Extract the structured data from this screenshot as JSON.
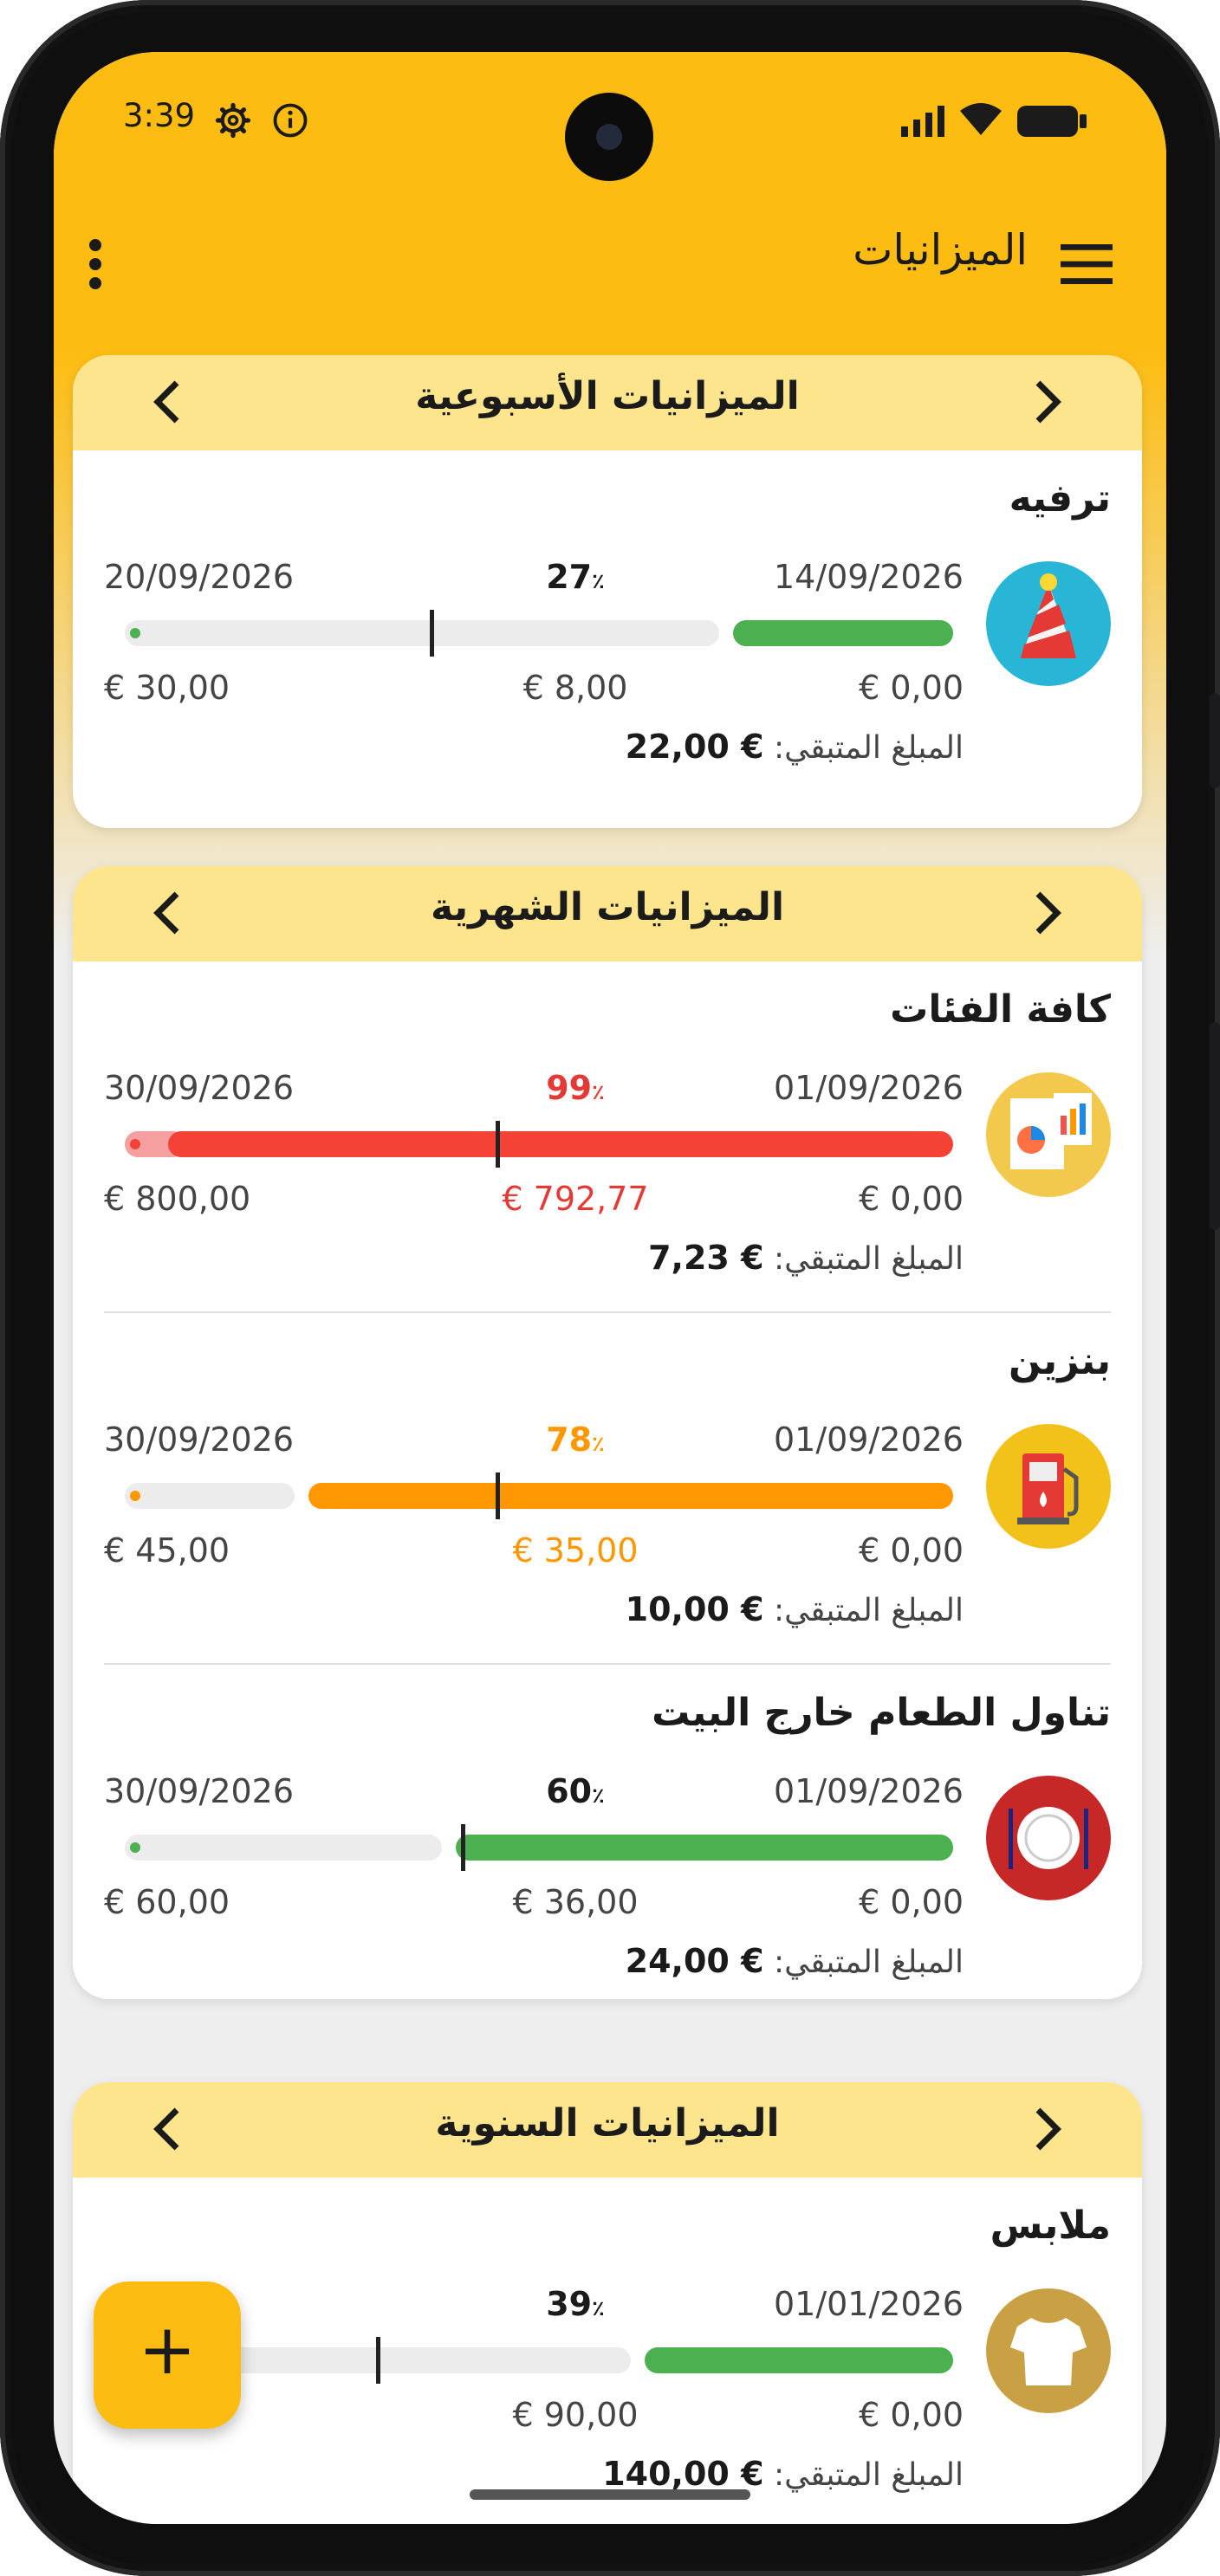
{
  "status_bar": {
    "time": "3:39"
  },
  "app_bar": {
    "title": "الميزانيات"
  },
  "sections": [
    {
      "title": "الميزانيات الأسبوعية",
      "items": [
        {
          "name": "ترفيه",
          "start_date": "14/09/2026",
          "end_date": "20/09/2026",
          "percent": "27",
          "percent_suffix": "٪",
          "amount_min": "€ 0,00",
          "amount_spent": "€ 8,00",
          "amount_max": "€ 30,00",
          "remaining_label": "المبلغ المتبقي:",
          "remaining_value": "€ 22,00",
          "icon": "party-hat-icon"
        }
      ]
    },
    {
      "title": "الميزانيات الشهرية",
      "items": [
        {
          "name": "كافة الفئات",
          "start_date": "01/09/2026",
          "end_date": "30/09/2026",
          "percent": "99",
          "percent_suffix": "٪",
          "amount_min": "€ 0,00",
          "amount_spent": "€ 792,77",
          "amount_max": "€ 800,00",
          "remaining_label": "المبلغ المتبقي:",
          "remaining_value": "€ 7,23",
          "icon": "reports-icon"
        },
        {
          "name": "بنزين",
          "start_date": "01/09/2026",
          "end_date": "30/09/2026",
          "percent": "78",
          "percent_suffix": "٪",
          "amount_min": "€ 0,00",
          "amount_spent": "€ 35,00",
          "amount_max": "€ 45,00",
          "remaining_label": "المبلغ المتبقي:",
          "remaining_value": "€ 10,00",
          "icon": "fuel-pump-icon"
        },
        {
          "name": "تناول الطعام خارج البيت",
          "start_date": "01/09/2026",
          "end_date": "30/09/2026",
          "percent": "60",
          "percent_suffix": "٪",
          "amount_min": "€ 0,00",
          "amount_spent": "€ 36,00",
          "amount_max": "€ 60,00",
          "remaining_label": "المبلغ المتبقي:",
          "remaining_value": "€ 24,00",
          "icon": "plate-cutlery-icon"
        }
      ]
    },
    {
      "title": "الميزانيات السنوية",
      "items": [
        {
          "name": "ملابس",
          "start_date": "01/01/2026",
          "end_date": "026",
          "percent": "39",
          "percent_suffix": "٪",
          "amount_min": "€ 0,00",
          "amount_spent": "€ 90,00",
          "amount_max": "",
          "remaining_label": "المبلغ المتبقي:",
          "remaining_value": "€ 140,00",
          "icon": "tshirt-icon"
        }
      ]
    }
  ],
  "fab": {
    "label": "+"
  },
  "colors": {
    "app_bar": "#fcbc12",
    "card_header": "#fde58e",
    "green": "#4caf50",
    "red": "#f44336",
    "orange": "#ff9800"
  }
}
